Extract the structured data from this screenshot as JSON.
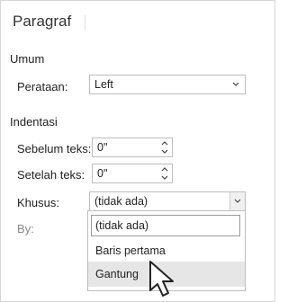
{
  "dialog": {
    "title": "Paragraf",
    "sections": {
      "general": "Umum",
      "indentation": "Indentasi"
    },
    "alignment": {
      "label": "Perataan:",
      "value": "Left"
    },
    "before_text": {
      "label": "Sebelum teks:",
      "value": "0\""
    },
    "after_text": {
      "label": "Setelah teks:",
      "value": "0\""
    },
    "special": {
      "label": "Khusus:",
      "value": "(tidak ada)",
      "options": [
        "(tidak ada)",
        "Baris pertama",
        "Gantung"
      ],
      "highlighted_option": "Gantung"
    },
    "by": {
      "label": "By:"
    }
  },
  "icons": [
    "chevron-down-icon",
    "spin-up-icon",
    "spin-down-icon",
    "mouse-pointer-icon"
  ],
  "colors": {
    "highlight": "#e6e6e6",
    "border": "#bdbdbd"
  }
}
